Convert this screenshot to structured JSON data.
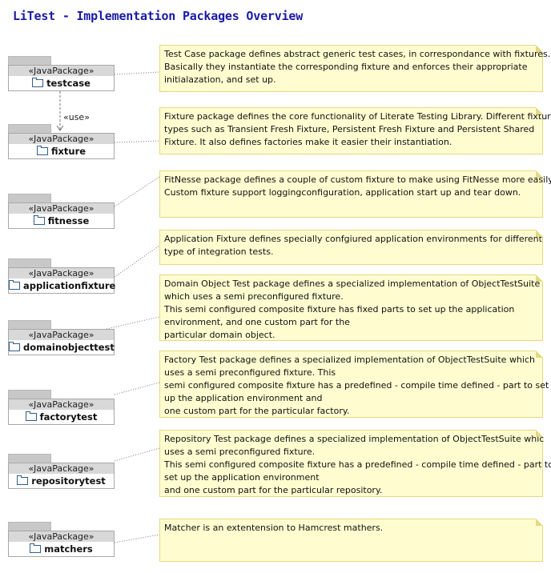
{
  "title": "LiTest - Implementation Packages Overview",
  "stereotype": "«JavaPackage»",
  "use_label": "«use»",
  "packages": [
    {
      "name": "testcase"
    },
    {
      "name": "fixture"
    },
    {
      "name": "fitnesse"
    },
    {
      "name": "applicationfixture"
    },
    {
      "name": "domainobjecttest"
    },
    {
      "name": "factorytest"
    },
    {
      "name": "repositorytest"
    },
    {
      "name": "matchers"
    }
  ],
  "notes": [
    {
      "lines": [
        "Test Case package defines abstract generic test cases, in correspondance with fixtures.",
        "Basically they instantiate the corresponding fixture and enforces their appropriate",
        "initialazation, and set up."
      ]
    },
    {
      "lines": [
        "Fixture package defines the core functionality of Literate Testing Library. Different fixture",
        "types such as Transient Fresh Fixture, Persistent Fresh Fixture and Persistent Shared",
        "Fixture. It also defines factories make it easier their instantiation."
      ]
    },
    {
      "lines": [
        "FitNesse package defines a couple of custom fixture to make using FitNesse more easily.",
        "Custom fixture support loggingconfiguration, application start up and tear down."
      ]
    },
    {
      "lines": [
        "Application Fixture defines specially confgiured application environments for different",
        "type of integration tests."
      ]
    },
    {
      "lines": [
        "Domain Object Test package defines a specialized implementation of ObjectTestSuite",
        "which uses a semi preconfigured fixture.",
        "This semi configured composite fixture has fixed parts to set up the application",
        "environment, and one custom part for the",
        "particular domain object."
      ]
    },
    {
      "lines": [
        "Factory Test package defines a specialized implementation of ObjectTestSuite which",
        "uses a semi preconfigured fixture. This",
        "semi configured composite fixture has a predefined - compile time defined - part to set",
        "up the application environment and",
        "one custom part for the particular factory."
      ]
    },
    {
      "lines": [
        "Repository Test package defines a specialized implementation of ObjectTestSuite whic",
        "uses a semi preconfigured fixture.",
        "This semi configured composite fixture has a predefined - compile time defined - part to",
        "set up the application environment",
        "and one custom part for the particular repository."
      ]
    },
    {
      "lines": [
        "Matcher is an extentension to Hamcrest mathers."
      ]
    }
  ]
}
